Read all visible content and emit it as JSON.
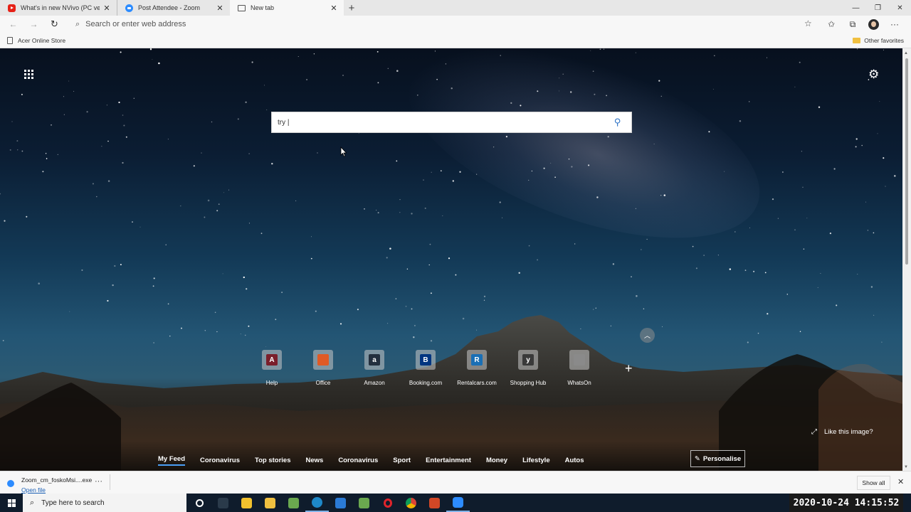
{
  "tabs": [
    {
      "title": "What's in new NVivo (PC version",
      "favicon": "youtube-icon"
    },
    {
      "title": "Post Attendee - Zoom",
      "favicon": "zoom-icon"
    },
    {
      "title": "New tab",
      "favicon": "new-tab-icon",
      "active": true
    }
  ],
  "address_bar": {
    "placeholder": "Search or enter web address"
  },
  "favorites": {
    "items": [
      "Acer Online Store"
    ],
    "other": "Other favorites"
  },
  "newtab": {
    "search_value": "try |",
    "quick_links": [
      {
        "label": "Help",
        "letter": "A",
        "color": "#7a1f2b"
      },
      {
        "label": "Office",
        "letter": "",
        "color": "#e05a25"
      },
      {
        "label": "Amazon",
        "letter": "a",
        "color": "#232f3e"
      },
      {
        "label": "Booking.com",
        "letter": "B",
        "color": "#003580"
      },
      {
        "label": "Rentalcars.com",
        "letter": "R",
        "color": "#1a6fb5"
      },
      {
        "label": "Shopping Hub",
        "letter": "y",
        "color": "#3a3a3a"
      },
      {
        "label": "WhatsOn",
        "letter": "",
        "color": "#8a8a8a"
      }
    ],
    "like_image": "Like this image?",
    "feed_tabs": [
      "My Feed",
      "Coronavirus",
      "Top stories",
      "News",
      "Coronavirus",
      "Sport",
      "Entertainment",
      "Money",
      "Lifestyle",
      "Autos"
    ],
    "personalise": "Personalise"
  },
  "download": {
    "filename": "Zoom_cm_foskoMsi....exe",
    "open": "Open file",
    "show_all": "Show all"
  },
  "taskbar": {
    "search_placeholder": "Type here to search",
    "icons": [
      "cortana-icon",
      "home-icon",
      "store-icon",
      "file-explorer-icon",
      "app-icon",
      "edge-icon",
      "mail-icon",
      "app-icon",
      "opera-icon",
      "chrome-icon",
      "powerpoint-icon",
      "zoom-icon"
    ],
    "clock": "2020-10-24  14:15:52"
  },
  "colors": {
    "accent": "#2e74c7",
    "taskbar": "#0f1c2c"
  }
}
